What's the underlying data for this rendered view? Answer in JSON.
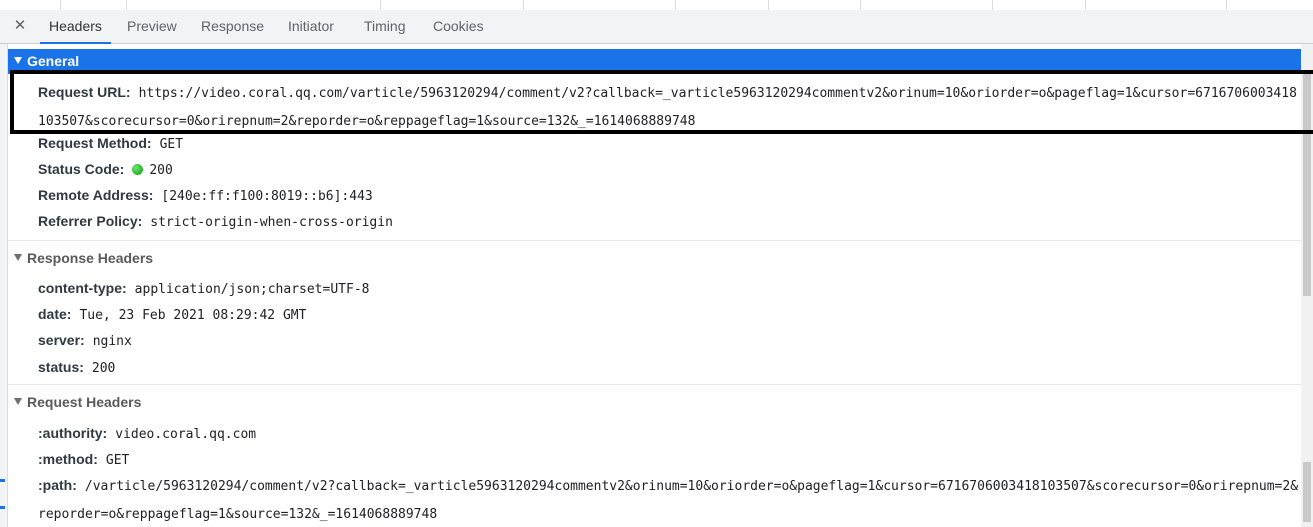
{
  "tabs": [
    {
      "label": "Headers",
      "active": true
    },
    {
      "label": "Preview",
      "active": false
    },
    {
      "label": "Response",
      "active": false
    },
    {
      "label": "Initiator",
      "active": false
    },
    {
      "label": "Timing",
      "active": false
    },
    {
      "label": "Cookies",
      "active": false
    }
  ],
  "close_glyph": "✕",
  "general": {
    "title": "General",
    "request_url_label": "Request URL:",
    "request_url": "https://video.coral.qq.com/varticle/5963120294/comment/v2?callback=_varticle5963120294commentv2&orinum=10&oriorder=o&pageflag=1&cursor=6716706003418103507&scorecursor=0&orirepnum=2&reporder=o&reppageflag=1&source=132&_=1614068889748",
    "request_method_label": "Request Method:",
    "request_method": "GET",
    "status_code_label": "Status Code:",
    "status_code": "200",
    "remote_address_label": "Remote Address:",
    "remote_address": "[240e:ff:f100:8019::b6]:443",
    "referrer_policy_label": "Referrer Policy:",
    "referrer_policy": "strict-origin-when-cross-origin"
  },
  "response_headers": {
    "title": "Response Headers",
    "items": [
      {
        "key": "content-type:",
        "value": "application/json;charset=UTF-8"
      },
      {
        "key": "date:",
        "value": "Tue, 23 Feb 2021 08:29:42 GMT"
      },
      {
        "key": "server:",
        "value": "nginx"
      },
      {
        "key": "status:",
        "value": "200"
      }
    ]
  },
  "request_headers": {
    "title": "Request Headers",
    "items": [
      {
        "key": ":authority:",
        "value": "video.coral.qq.com"
      },
      {
        "key": ":method:",
        "value": "GET"
      },
      {
        "key": ":path:",
        "value": "/varticle/5963120294/comment/v2?callback=_varticle5963120294commentv2&orinum=10&oriorder=o&pageflag=1&cursor=6716706003418103507&scorecursor=0&orirepnum=2&reporder=o&reppageflag=1&source=132&_=1614068889748"
      }
    ]
  },
  "colors": {
    "selected_header": "#1a73e8",
    "status_dot": "#0a9e0a",
    "annotation_box": "#000000"
  }
}
